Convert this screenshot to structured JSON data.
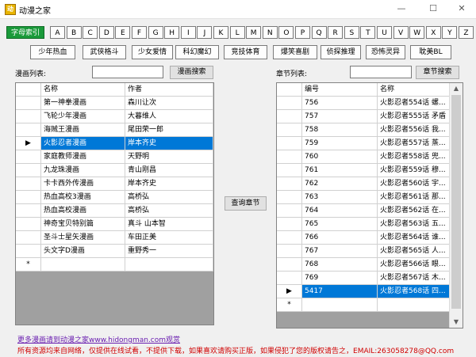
{
  "window": {
    "title": "动漫之家",
    "minimize": "—",
    "maximize": "☐",
    "close": "✕",
    "icon": "app-icon"
  },
  "alpha_buttons": [
    "字母索引",
    "A",
    "B",
    "C",
    "D",
    "E",
    "F",
    "G",
    "H",
    "I",
    "J",
    "K",
    "L",
    "M",
    "N",
    "O",
    "P",
    "Q",
    "R",
    "S",
    "T",
    "U",
    "V",
    "W",
    "X",
    "Y",
    "Z"
  ],
  "category_buttons": [
    "少年热血",
    "武侠格斗",
    "少女爱情",
    "科幻魔幻",
    "竞技体育",
    "爆笑喜剧",
    "侦探推理",
    "恐怖灵异",
    "耽美BL"
  ],
  "comic_panel": {
    "label": "漫画列表:",
    "search_value": "",
    "search_button": "漫画搜索",
    "columns": [
      "名称",
      "作者"
    ],
    "rows": [
      [
        "第一神拳漫画",
        "森川让次"
      ],
      [
        "飞轮少年漫画",
        "大暮维人"
      ],
      [
        "海贼王漫画",
        "尾田荣一郎"
      ],
      [
        "火影忍者漫画",
        "岸本齐史"
      ],
      [
        "家庭教师漫画",
        "天野明"
      ],
      [
        "九龙珠漫画",
        "青山刚昌"
      ],
      [
        "卡卡西外传漫画",
        "岸本齐史"
      ],
      [
        "热血高校3漫画",
        "高桥弘"
      ],
      [
        "热血高校漫画",
        "高桥弘"
      ],
      [
        "神奇宝贝特别篇",
        "真斗 山本智"
      ],
      [
        "圣斗士星矢漫画",
        "车田正美"
      ],
      [
        "头文字D漫画",
        "重野秀一"
      ]
    ],
    "selected_index": 3,
    "new_row_marker": "*",
    "row_pointer": "▶"
  },
  "query_button": "查询章节",
  "chapter_panel": {
    "label": "章节列表:",
    "search_value": "",
    "search_button": "章节搜索",
    "columns": [
      "编号",
      "名称"
    ],
    "rows": [
      [
        "756",
        "火影忍者554话 螺..."
      ],
      [
        "757",
        "火影忍者555话 矛盾"
      ],
      [
        "758",
        "火影忍者556话 我..."
      ],
      [
        "759",
        "火影忍者557话 蒸..."
      ],
      [
        "760",
        "火影忍者558话 兜..."
      ],
      [
        "761",
        "火影忍者559话 穆..."
      ],
      [
        "762",
        "火影忍者560话 宇..."
      ],
      [
        "763",
        "火影忍者561话 那..."
      ],
      [
        "764",
        "火影忍者562话 在..."
      ],
      [
        "765",
        "火影忍者563话 五..."
      ],
      [
        "766",
        "火影忍者564话 谁..."
      ],
      [
        "767",
        "火影忍者565话 人..."
      ],
      [
        "768",
        "火影忍者566话 眼..."
      ],
      [
        "769",
        "火影忍者567话 木..."
      ],
      [
        "5417",
        "火影忍者568话 四..."
      ]
    ],
    "selected_index": 14,
    "new_row_marker": "*",
    "row_pointer": "▶"
  },
  "footer": {
    "link": "更多漫画请到动漫之家www.hidongman.com观赏",
    "notice": "所有资源均来自网络，仅提供在线试看，不提供下载，如果喜欢请购买正版，如果侵犯了您的版权请告之，EMAIL:263058278@QQ.com"
  }
}
